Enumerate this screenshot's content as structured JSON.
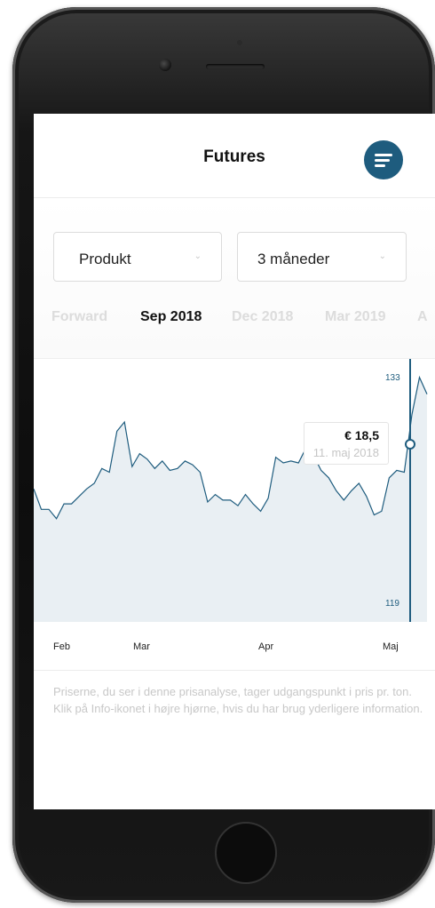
{
  "header": {
    "title": "Futures",
    "menu_icon": "filter-lines-icon",
    "accent_color": "#1e5c7e"
  },
  "filters": {
    "product_select": {
      "value": "Produkt"
    },
    "period_select": {
      "value": "3 måneder"
    }
  },
  "tabs": [
    {
      "label": "Forward",
      "active": false
    },
    {
      "label": "Sep 2018",
      "active": true
    },
    {
      "label": "Dec 2018",
      "active": false
    },
    {
      "label": "Mar 2019",
      "active": false
    },
    {
      "label": "A",
      "active": false
    }
  ],
  "chart": {
    "y_max_label": "133",
    "y_min_label": "119",
    "tooltip": {
      "value": "€ 18,5",
      "date": "11. maj 2018"
    },
    "x_labels": [
      "Feb",
      "Mar",
      "Apr",
      "Maj"
    ]
  },
  "chart_data": {
    "type": "area",
    "ylim": [
      119,
      133
    ],
    "series": [
      {
        "values": [
          126.2,
          125.1,
          125.1,
          124.6,
          125.4,
          125.4,
          125.8,
          126.2,
          126.5,
          127.3,
          127.1,
          129.3,
          129.8,
          127.4,
          128.1,
          127.8,
          127.3,
          127.7,
          127.2,
          127.3,
          127.7,
          127.5,
          127.1,
          125.5,
          125.9,
          125.6,
          125.6,
          125.3,
          125.9,
          125.4,
          125.0,
          125.7,
          127.9,
          127.6,
          127.7,
          127.6,
          128.4,
          128.0,
          127.2,
          126.8,
          126.1,
          125.6,
          126.1,
          126.5,
          125.8,
          124.8,
          125.0,
          126.8,
          127.2,
          127.1,
          130.2,
          132.2,
          131.3
        ]
      }
    ],
    "grid": false
  }
}
